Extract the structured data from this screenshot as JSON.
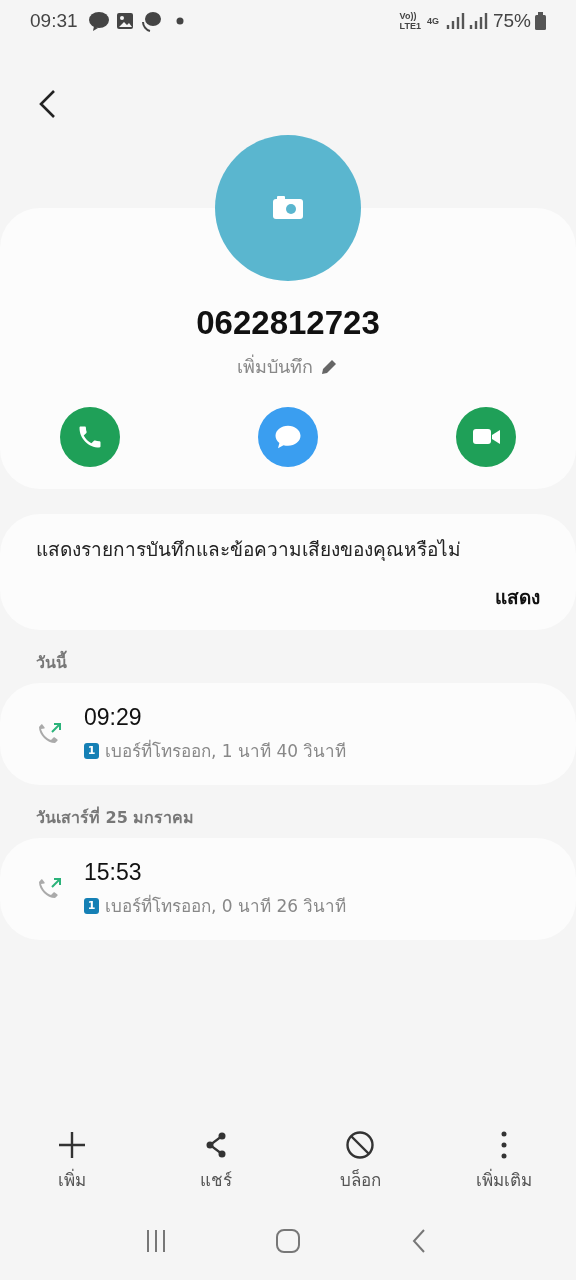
{
  "status_bar": {
    "time": "09:31",
    "network_top": "Vo))",
    "network_bottom": "LTE1",
    "data_type": "4G",
    "battery": "75%"
  },
  "contact": {
    "number": "0622812723",
    "note_action": "เพิ่มบันทึก",
    "actions": [
      {
        "kind": "call"
      },
      {
        "kind": "message"
      },
      {
        "kind": "video"
      }
    ]
  },
  "recording_prompt": {
    "text": "แสดงรายการบันทึกและข้อความเสียงของคุณหรือไม่",
    "action": "แสดง"
  },
  "call_groups": [
    {
      "header": "วันนี้",
      "calls": [
        {
          "time": "09:29",
          "sim": "1",
          "detail": "เบอร์ที่โทรออก, 1 นาที 40 วินาที"
        }
      ]
    },
    {
      "header": "วันเสาร์ที่ 25 มกราคม",
      "calls": [
        {
          "time": "15:53",
          "sim": "1",
          "detail": "เบอร์ที่โทรออก, 0 นาที 26 วินาที"
        }
      ]
    }
  ],
  "bottom_actions": [
    {
      "kind": "add",
      "label": "เพิ่ม"
    },
    {
      "kind": "share",
      "label": "แชร์"
    },
    {
      "kind": "block",
      "label": "บล็อก"
    },
    {
      "kind": "more",
      "label": "เพิ่มเติม"
    }
  ]
}
